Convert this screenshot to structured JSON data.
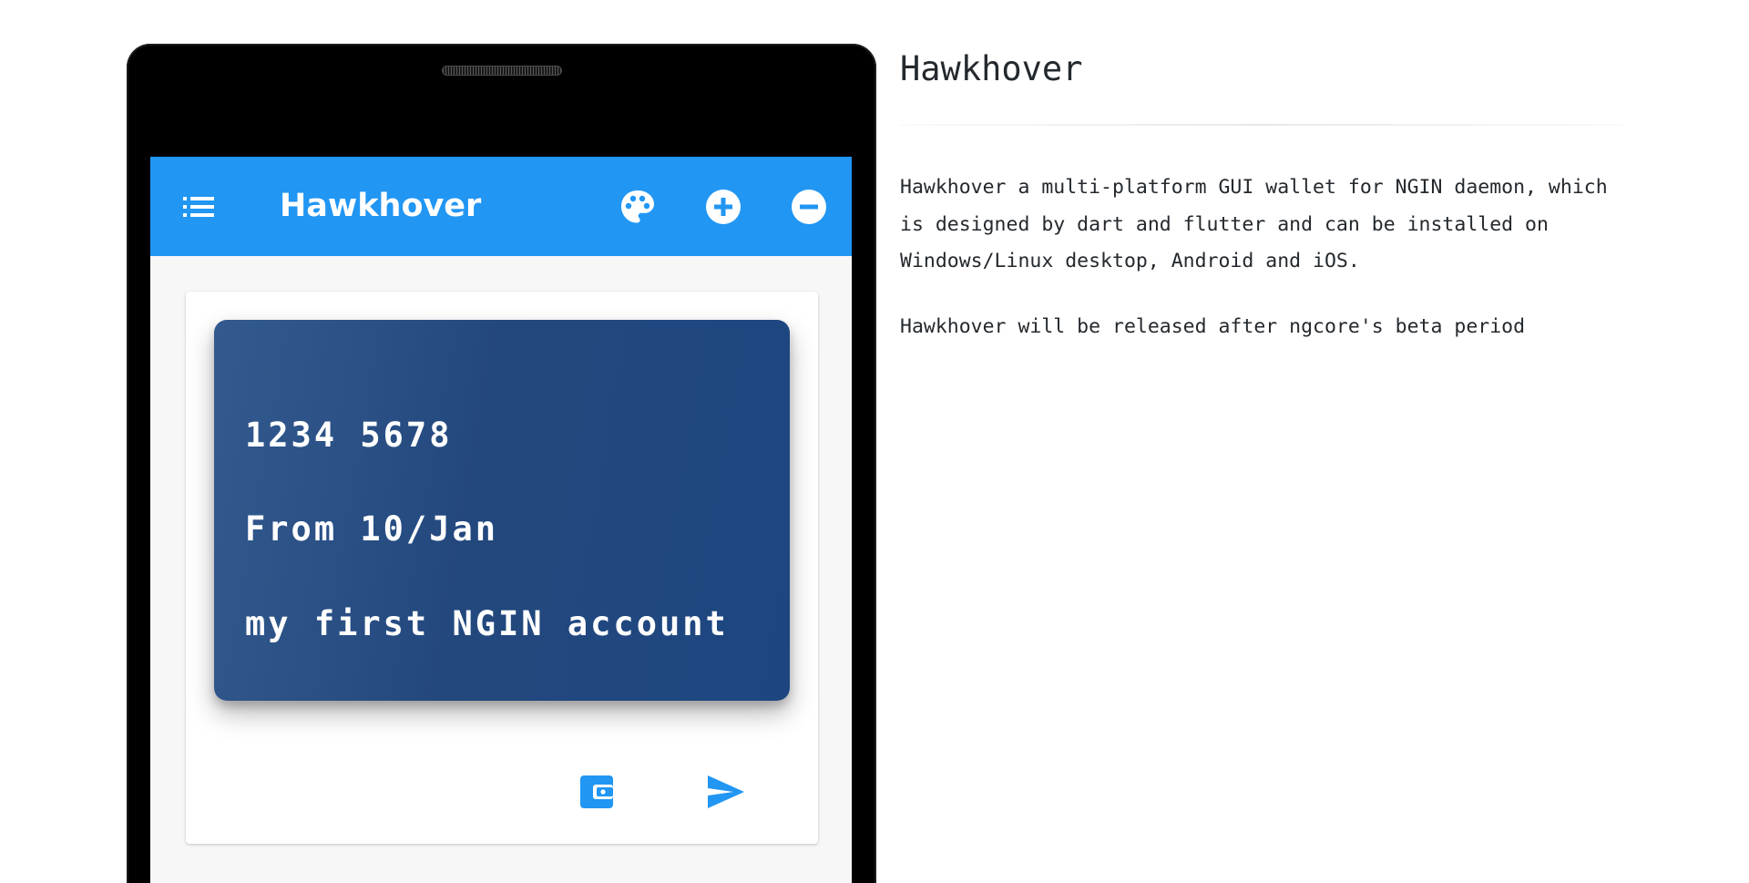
{
  "app": {
    "title": "Hawkhover"
  },
  "appbar": {
    "icons": {
      "menu": "list-icon",
      "palette": "palette-icon",
      "add": "add-circle-icon",
      "remove": "remove-circle-icon"
    }
  },
  "wallet_card": {
    "number": "1234 5678",
    "since": "From 10/Jan",
    "name": "my first NGIN account"
  },
  "card_actions": {
    "icons": [
      "wallet-icon",
      "send-icon"
    ]
  },
  "description": {
    "heading": "Hawkhover",
    "paragraph1": "Hawkhover a multi-platform GUI wallet for NGIN daemon, which is designed by dart and flutter and can be installed on Windows/Linux desktop, Android and iOS.",
    "paragraph2": "Hawkhover will be released after ngcore's beta period"
  },
  "colors": {
    "appbar": "#2196f3",
    "card_start": "#335a8e",
    "card_end": "#1d4680",
    "icon_blue": "#2196f3",
    "text": "#24292e"
  }
}
